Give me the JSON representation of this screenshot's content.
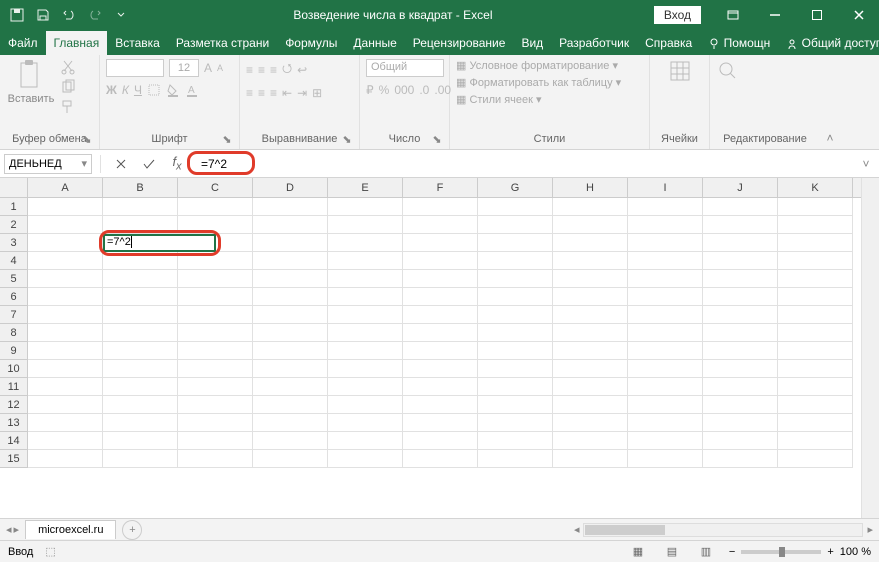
{
  "titlebar": {
    "title": "Возведение числа в квадрат  -  Excel",
    "login": "Вход"
  },
  "tabs": {
    "file": "Файл",
    "home": "Главная",
    "insert": "Вставка",
    "layout": "Разметка страни",
    "formulas": "Формулы",
    "data": "Данные",
    "review": "Рецензирование",
    "view": "Вид",
    "developer": "Разработчик",
    "help": "Справка",
    "tellme": "Помощн",
    "share": "Общий доступ"
  },
  "ribbon": {
    "clipboard": {
      "label": "Буфер обмена",
      "paste": "Вставить"
    },
    "font": {
      "label": "Шрифт",
      "size": "12"
    },
    "alignment": {
      "label": "Выравнивание"
    },
    "number": {
      "label": "Число",
      "format": "Общий"
    },
    "styles": {
      "label": "Стили",
      "conditional": "Условное форматирование",
      "table": "Форматировать как таблицу",
      "cellstyles": "Стили ячеек"
    },
    "cells": {
      "label": "Ячейки"
    },
    "editing": {
      "label": "Редактирование"
    }
  },
  "formula_bar": {
    "namebox": "ДЕНЬНЕД",
    "formula": "=7^2"
  },
  "grid": {
    "columns": [
      "A",
      "B",
      "C",
      "D",
      "E",
      "F",
      "G",
      "H",
      "I",
      "J",
      "K"
    ],
    "rows": [
      "1",
      "2",
      "3",
      "4",
      "5",
      "6",
      "7",
      "8",
      "9",
      "10",
      "11",
      "12",
      "13",
      "14",
      "15"
    ],
    "active_cell": {
      "row": 3,
      "col": "B",
      "value": "=7^2"
    }
  },
  "sheets": {
    "active": "microexcel.ru"
  },
  "status": {
    "mode": "Ввод",
    "zoom": "100 %"
  }
}
